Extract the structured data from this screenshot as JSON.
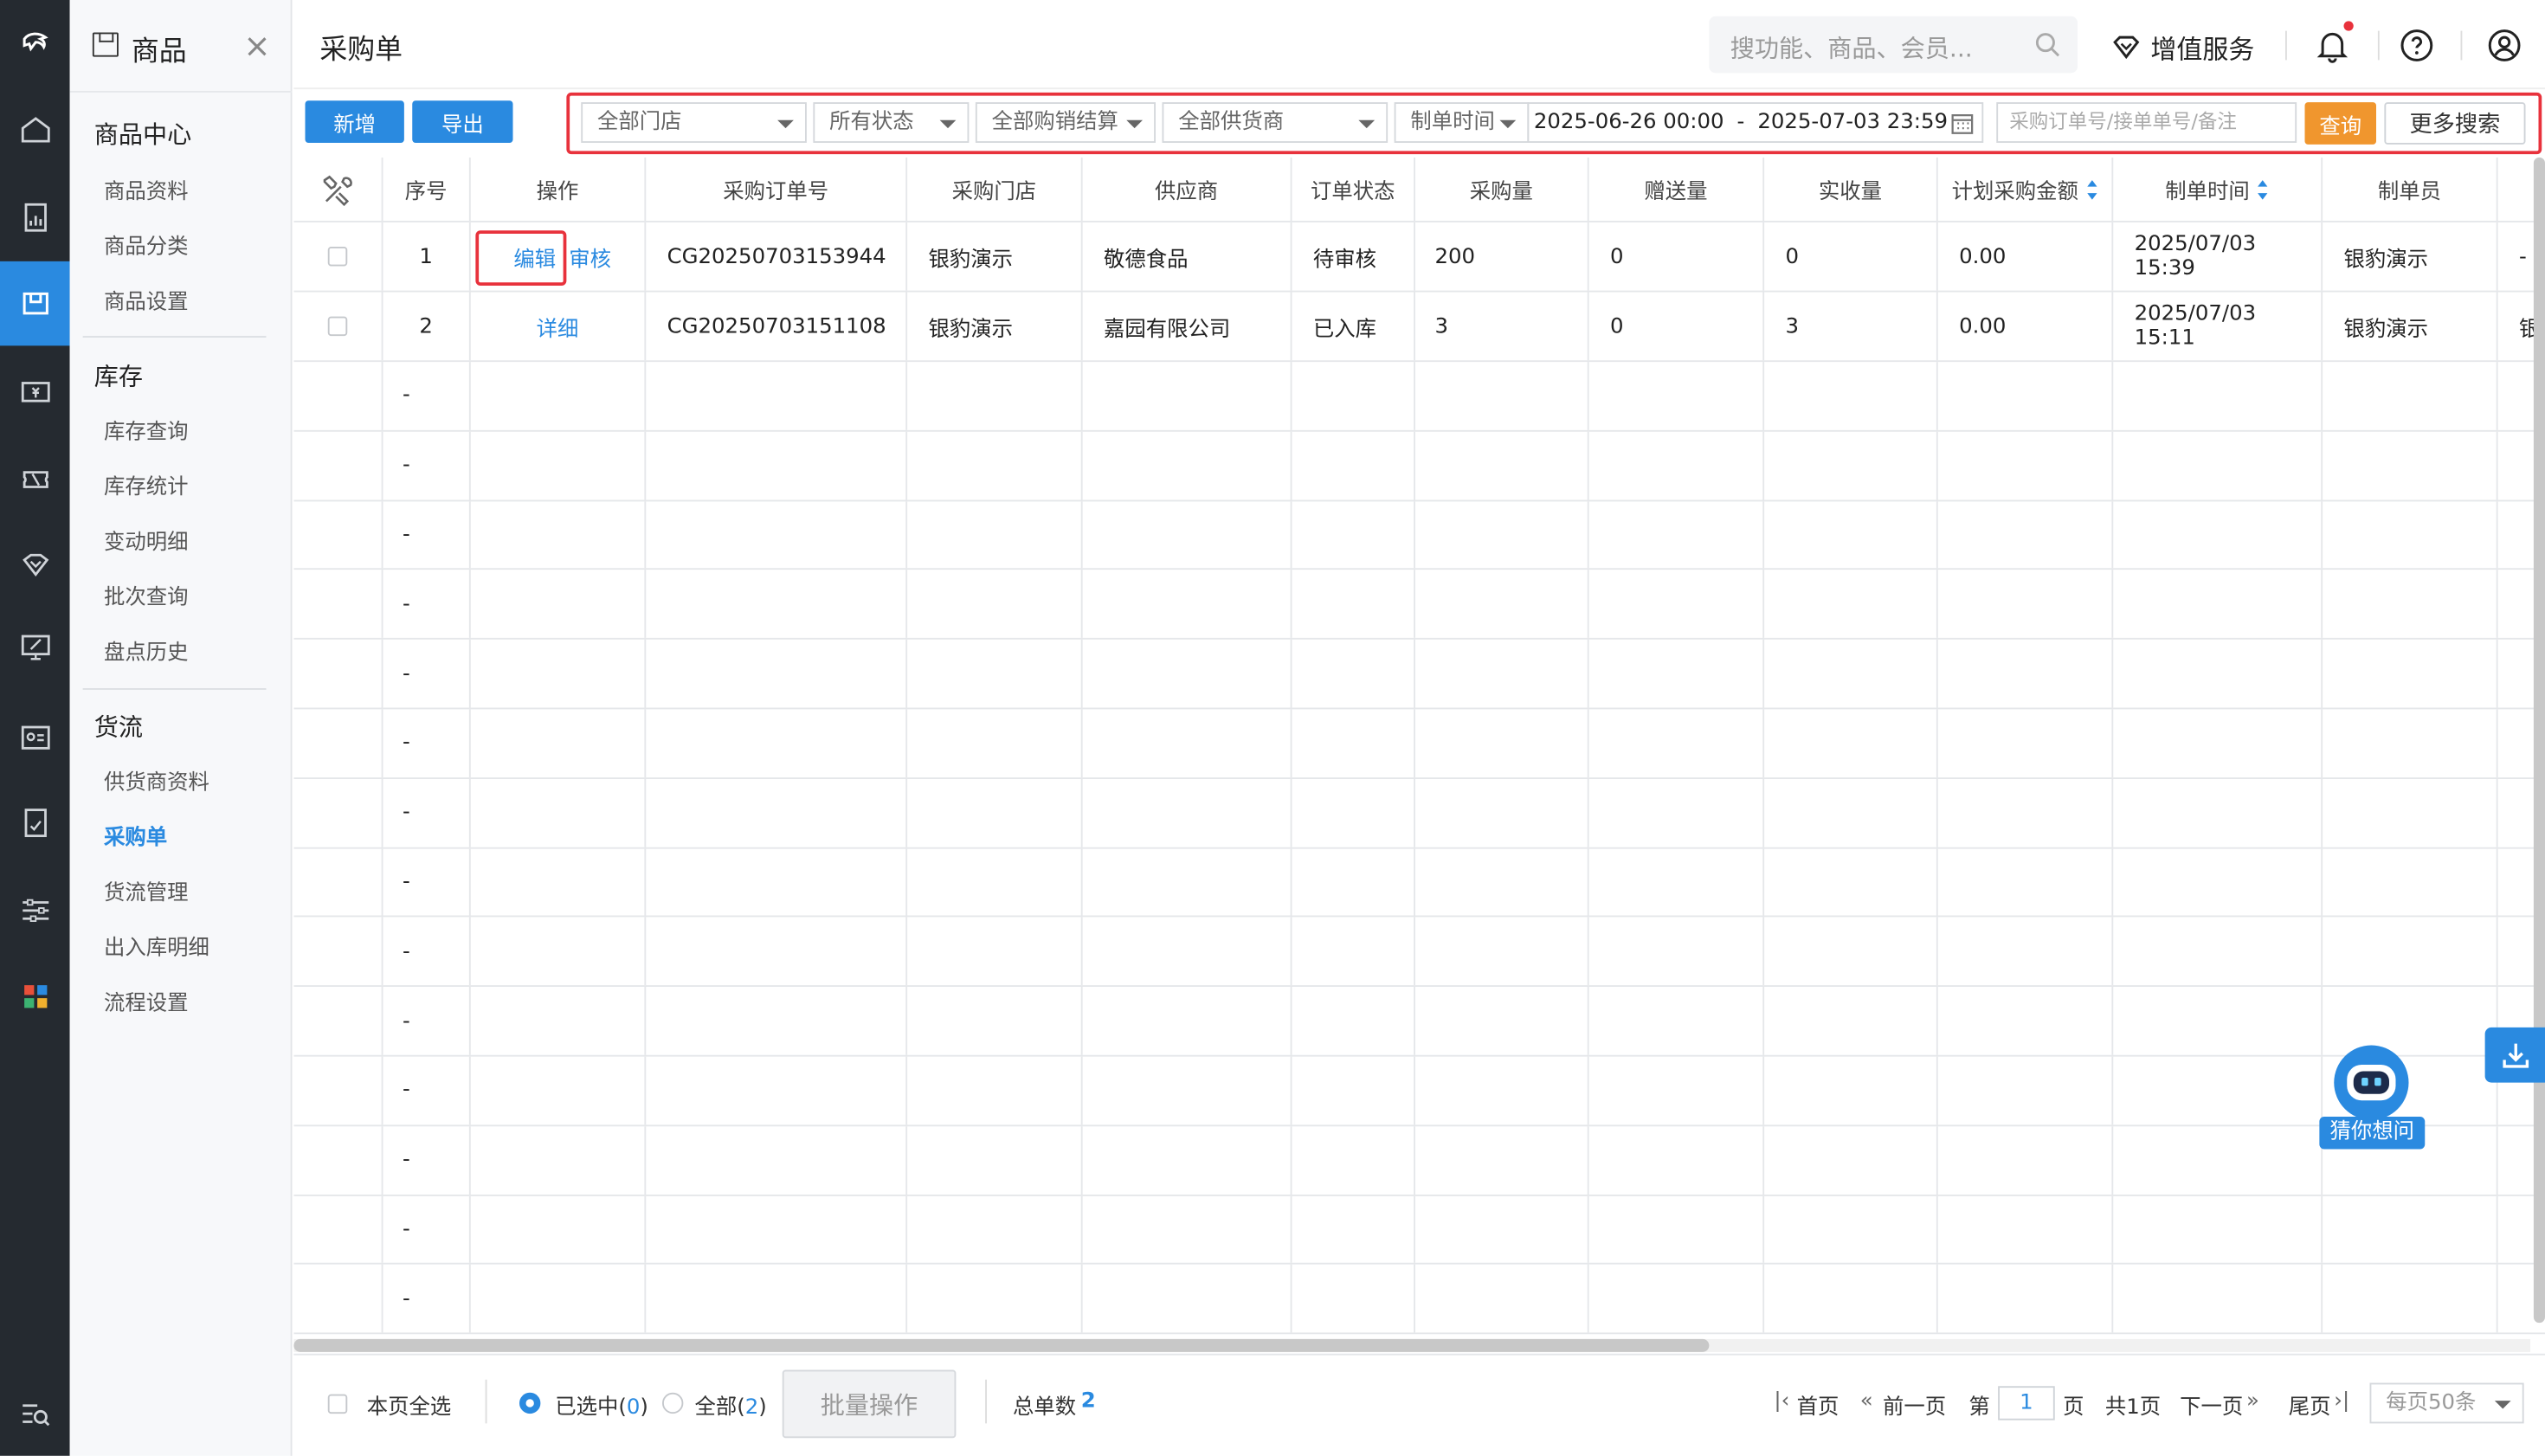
{
  "colors": {
    "accent": "#2a8ae0",
    "query": "#f0962e",
    "highlight": "#e8323c",
    "rail": "#252a30"
  },
  "nav": {
    "title": "商品",
    "close": "×",
    "groups": [
      {
        "label": "商品中心",
        "items": [
          "商品资料",
          "商品分类",
          "商品设置"
        ]
      },
      {
        "label": "库存",
        "items": [
          "库存查询",
          "库存统计",
          "变动明细",
          "批次查询",
          "盘点历史"
        ]
      },
      {
        "label": "货流",
        "items": [
          "供货商资料",
          "采购单",
          "货流管理",
          "出入库明细",
          "流程设置"
        ]
      }
    ],
    "active_item": "采购单"
  },
  "header": {
    "title": "采购单",
    "search_placeholder": "搜功能、商品、会员...",
    "vas_label": "增值服务"
  },
  "toolbar": {
    "add": "新增",
    "export": "导出",
    "store": "全部门店",
    "status": "所有状态",
    "settle": "全部购销结算",
    "supplier": "全部供货商",
    "time_type": "制单时间",
    "date_start": "2025-06-26 00:00",
    "date_sep": "-",
    "date_end": "2025-07-03 23:59",
    "keyword_placeholder": "采购订单号/接单单号/备注",
    "query": "查询",
    "more": "更多搜索"
  },
  "table": {
    "headers": [
      "序号",
      "操作",
      "采购订单号",
      "采购门店",
      "供应商",
      "订单状态",
      "采购量",
      "赠送量",
      "实收量",
      "计划采购金额",
      "制单时间",
      "制单员"
    ],
    "rows": [
      {
        "no": "1",
        "ops": [
          "编辑",
          "审核"
        ],
        "order": "CG20250703153944",
        "store": "银豹演示",
        "supplier": "敬德食品",
        "status": "待审核",
        "qty": "200",
        "gift": "0",
        "recv": "0",
        "amount": "0.00",
        "time": "2025/07/03 15:39",
        "maker": "银豹演示",
        "extra": "-"
      },
      {
        "no": "2",
        "ops": [
          "详细"
        ],
        "order": "CG20250703151108",
        "store": "银豹演示",
        "supplier": "嘉园有限公司",
        "status": "已入库",
        "qty": "3",
        "gift": "0",
        "recv": "3",
        "amount": "0.00",
        "time": "2025/07/03 15:11",
        "maker": "银豹演示",
        "extra": "银"
      }
    ],
    "empty_mark": "-"
  },
  "footer": {
    "select_page": "本页全选",
    "selected_label": "已选中(",
    "selected_count": "0",
    "all_label": "全部(",
    "all_count": "2",
    "close_paren": ")",
    "batch": "批量操作",
    "total_label": "总单数",
    "total": "2",
    "first": "首页",
    "prev": "前一页",
    "page_prefix": "第",
    "page": "1",
    "page_suffix": "页",
    "pages": "共1页",
    "next": "下一页",
    "last": "尾页",
    "per_page": "每页50条"
  },
  "bot": {
    "label": "猜你想问"
  }
}
